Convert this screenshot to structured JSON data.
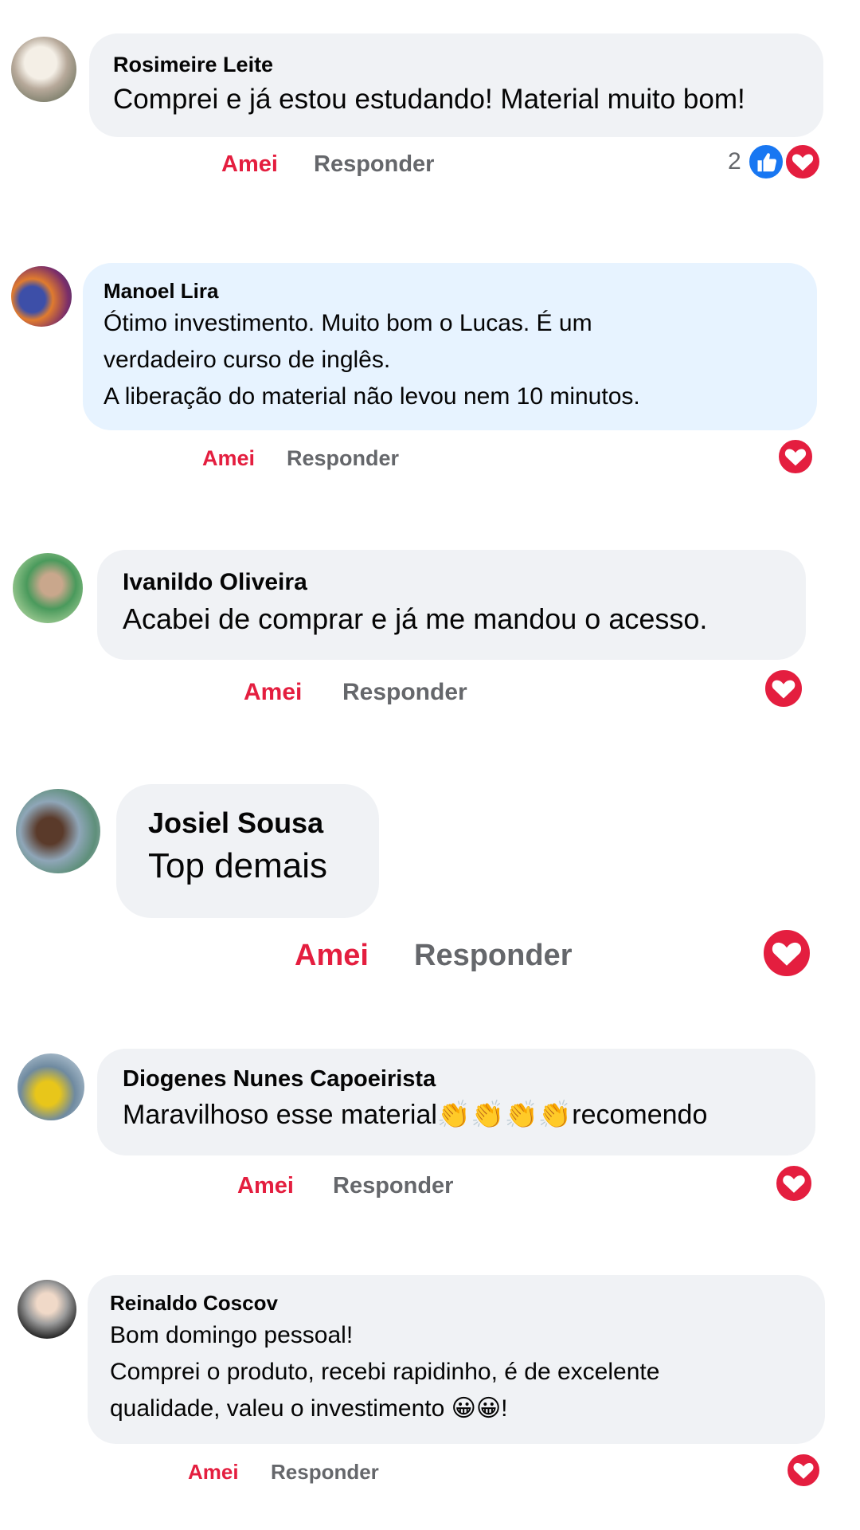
{
  "comments": [
    {
      "author": "Rosimeire Leite",
      "text": "Comprei e já estou estudando! Material muito bom!",
      "actions": {
        "love": "Amei",
        "reply": "Responder"
      },
      "reaction_count": "2",
      "reactions": [
        "like-icon",
        "love-icon"
      ]
    },
    {
      "author": "Manoel Lira",
      "text": "Ótimo investimento. Muito bom o Lucas. É um\nverdadeiro curso de inglês.\nA liberação do material não levou nem 10 minutos.",
      "actions": {
        "love": "Amei",
        "reply": "Responder"
      },
      "reactions": [
        "love-icon"
      ]
    },
    {
      "author": "Ivanildo Oliveira",
      "text": "Acabei de comprar e já me mandou o acesso.",
      "actions": {
        "love": "Amei",
        "reply": "Responder"
      },
      "reactions": [
        "love-icon"
      ]
    },
    {
      "author": "Josiel Sousa",
      "text": "Top demais",
      "actions": {
        "love": "Amei",
        "reply": "Responder"
      },
      "reactions": [
        "love-icon"
      ]
    },
    {
      "author": "Diogenes Nunes Capoeirista",
      "text": "Maravilhoso esse material👏👏👏👏recomendo",
      "actions": {
        "love": "Amei",
        "reply": "Responder"
      },
      "reactions": [
        "love-icon"
      ]
    },
    {
      "author": "Reinaldo Coscov",
      "text": "Bom domingo pessoal!\nComprei o produto, recebi rapidinho, é de excelente\nqualidade, valeu o investimento 😀😀!",
      "actions": {
        "love": "Amei",
        "reply": "Responder"
      },
      "reactions": [
        "love-icon"
      ]
    }
  ],
  "colors": {
    "love": "#e41e3f",
    "reply": "#65676b",
    "like": "#1877f2",
    "bubble": "#f0f2f5",
    "bubble_highlight": "#e7f3ff"
  }
}
